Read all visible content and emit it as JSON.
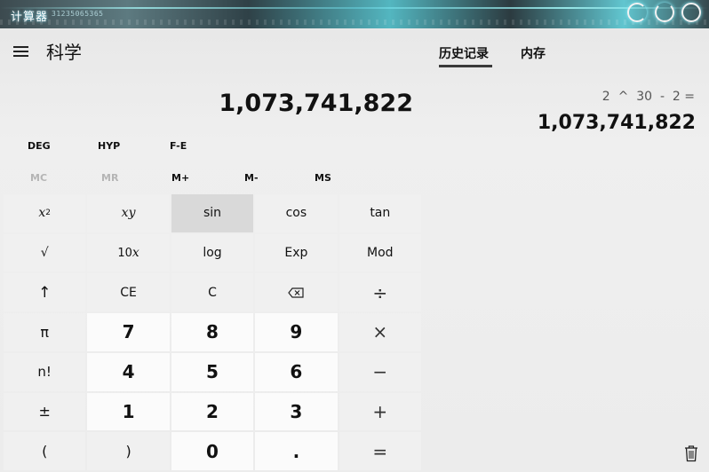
{
  "titlebar": {
    "title": "计算器",
    "deco_digits": "31235065365"
  },
  "header": {
    "mode": "科学"
  },
  "tabs": [
    {
      "label": "历史记录"
    },
    {
      "label": "内存"
    }
  ],
  "display": {
    "value": "1,073,741,822"
  },
  "mode_buttons": [
    "DEG",
    "HYP",
    "F-E"
  ],
  "memory_buttons": [
    {
      "label": "MC",
      "enabled": false
    },
    {
      "label": "MR",
      "enabled": false
    },
    {
      "label": "M+",
      "enabled": true
    },
    {
      "label": "M-",
      "enabled": true
    },
    {
      "label": "MS",
      "enabled": true
    }
  ],
  "keys": {
    "x2_base": "x",
    "x2_exp": "2",
    "xy_base": "x",
    "xy_exp": "y",
    "sin": "sin",
    "cos": "cos",
    "tan": "tan",
    "sqrt": "√",
    "ten_base": "10",
    "ten_exp": "x",
    "log": "log",
    "exp": "Exp",
    "mod": "Mod",
    "shift": "↑",
    "ce": "CE",
    "c": "C",
    "backspace": "⌫",
    "divide": "÷",
    "pi": "π",
    "d7": "7",
    "d8": "8",
    "d9": "9",
    "multiply": "×",
    "fact": "n!",
    "d4": "4",
    "d5": "5",
    "d6": "6",
    "minus": "−",
    "negate": "±",
    "d1": "1",
    "d2": "2",
    "d3": "3",
    "plus": "+",
    "lparen": "(",
    "rparen": ")",
    "d0": "0",
    "dot": ".",
    "equals": "="
  },
  "history": {
    "expression": "2  ^  30  -  2 =",
    "result": "1,073,741,822"
  },
  "colors": {
    "accent": "#3a3a3a",
    "key_hover": "#d9d9d9",
    "key_num": "#fbfbfb"
  }
}
